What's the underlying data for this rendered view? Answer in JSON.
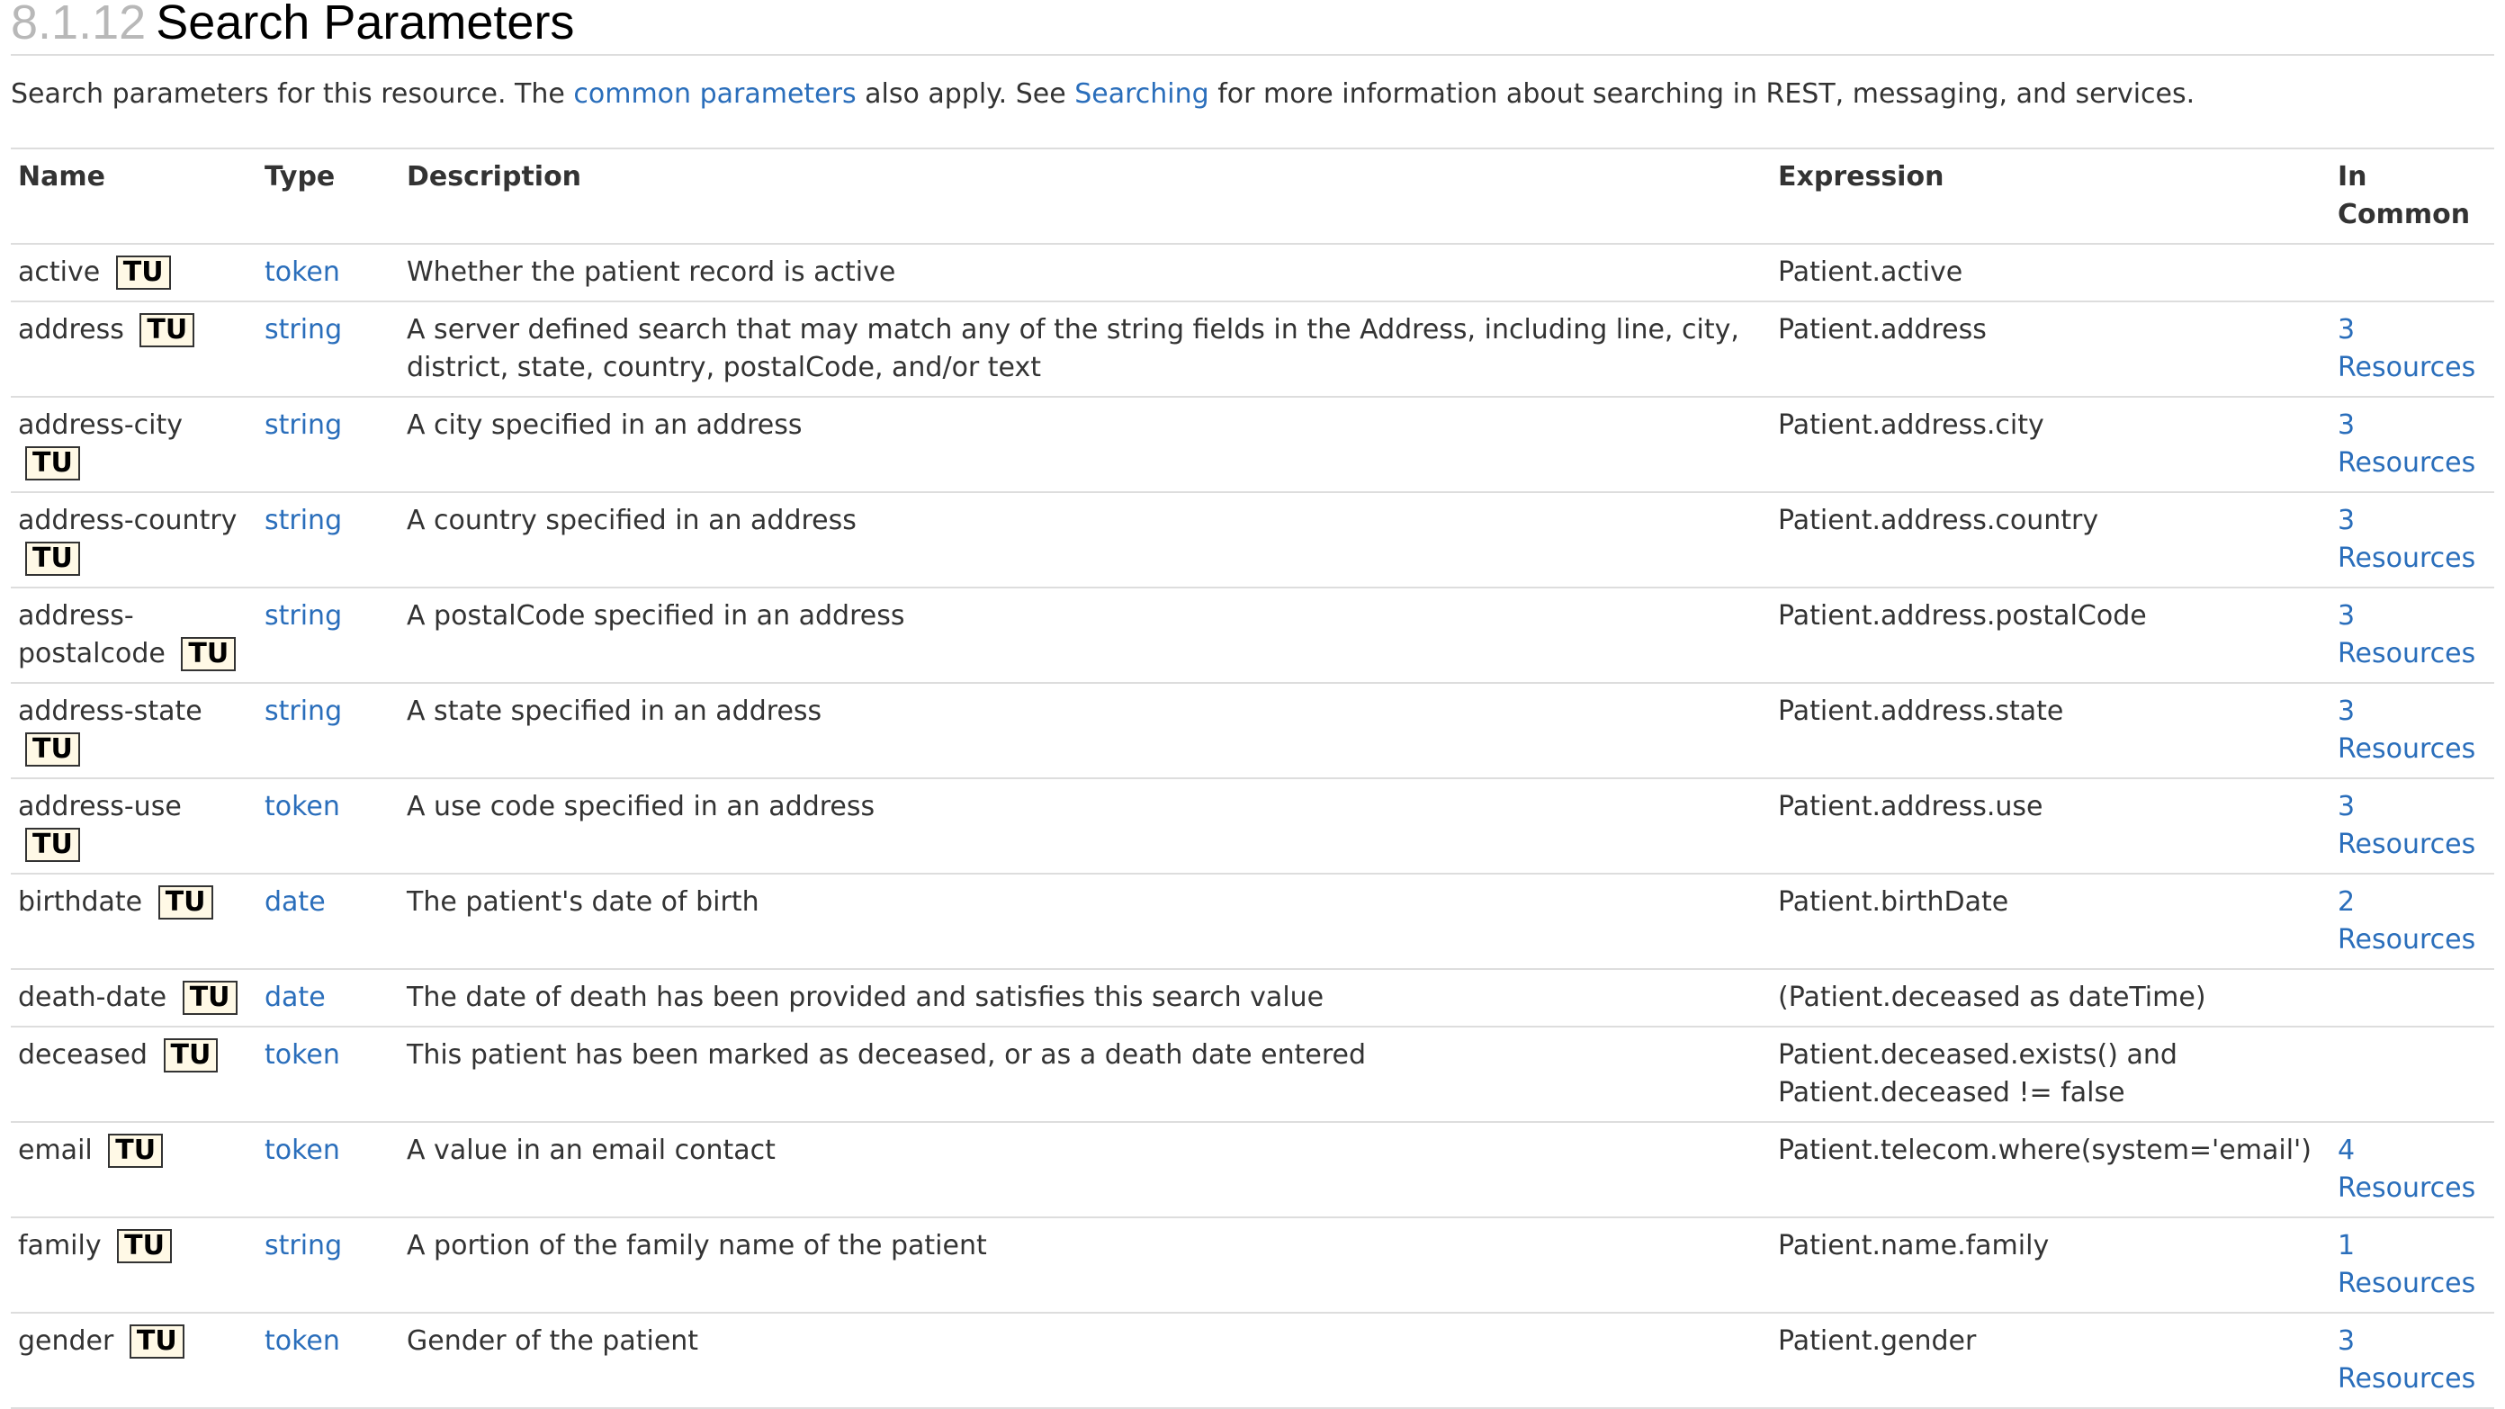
{
  "heading": {
    "number": "8.1.12",
    "title": "Search Parameters"
  },
  "intro": {
    "text1": "Search parameters for this resource. The ",
    "link1": "common parameters",
    "text2": " also apply. See ",
    "link2": "Searching",
    "text3": " for more information about searching in REST, messaging, and services."
  },
  "table": {
    "headers": {
      "name": "Name",
      "type": "Type",
      "description": "Description",
      "expression": "Expression",
      "in_common": "In Common"
    },
    "badge": "TU",
    "rows": [
      {
        "name": "active",
        "type": "token",
        "description": "Whether the patient record is active",
        "expression": "Patient.active",
        "in_common": ""
      },
      {
        "name": "address",
        "type": "string",
        "description": "A server defined search that may match any of the string fields in the Address, including line, city, district, state, country, postalCode, and/or text",
        "expression": "Patient.address",
        "in_common": "3 Resources"
      },
      {
        "name": "address-city",
        "type": "string",
        "description": "A city specified in an address",
        "expression": "Patient.address.city",
        "in_common": "3 Resources"
      },
      {
        "name": "address-country",
        "type": "string",
        "description": "A country specified in an address",
        "expression": "Patient.address.country",
        "in_common": "3 Resources"
      },
      {
        "name": "address-postalcode",
        "type": "string",
        "description": "A postalCode specified in an address",
        "expression": "Patient.address.postalCode",
        "in_common": "3 Resources"
      },
      {
        "name": "address-state",
        "type": "string",
        "description": "A state specified in an address",
        "expression": "Patient.address.state",
        "in_common": "3 Resources"
      },
      {
        "name": "address-use",
        "type": "token",
        "description": "A use code specified in an address",
        "expression": "Patient.address.use",
        "in_common": "3 Resources"
      },
      {
        "name": "birthdate",
        "type": "date",
        "description": "The patient's date of birth",
        "expression": "Patient.birthDate",
        "in_common": "2 Resources"
      },
      {
        "name": "death-date",
        "type": "date",
        "description": "The date of death has been provided and satisfies this search value",
        "expression": "(Patient.deceased as dateTime)",
        "in_common": ""
      },
      {
        "name": "deceased",
        "type": "token",
        "description": "This patient has been marked as deceased, or as a death date entered",
        "expression": "Patient.deceased.exists() and Patient.deceased != false",
        "in_common": ""
      },
      {
        "name": "email",
        "type": "token",
        "description": "A value in an email contact",
        "expression": "Patient.telecom.where(system='email')",
        "in_common": "4 Resources"
      },
      {
        "name": "family",
        "type": "string",
        "description": "A portion of the family name of the patient",
        "expression": "Patient.name.family",
        "in_common": "1 Resources"
      },
      {
        "name": "gender",
        "type": "token",
        "description": "Gender of the patient",
        "expression": "Patient.gender",
        "in_common": "3 Resources"
      }
    ]
  }
}
